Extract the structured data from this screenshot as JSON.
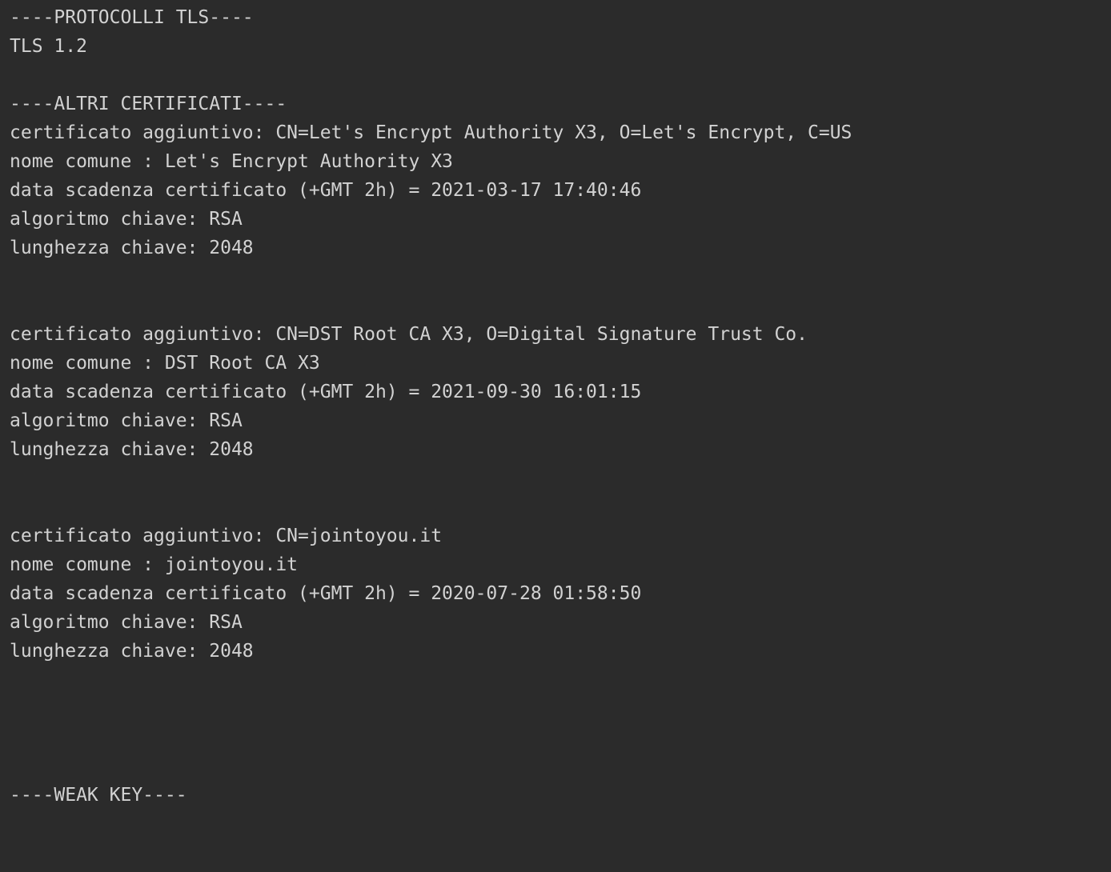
{
  "console": {
    "tls_header": "----PROTOCOLLI TLS----",
    "tls_version": "TLS 1.2",
    "certs_header": "----ALTRI CERTIFICATI----",
    "certificates": [
      {
        "aggiuntivo": "certificato aggiuntivo: CN=Let's Encrypt Authority X3, O=Let's Encrypt, C=US",
        "nome_comune": "nome comune : Let's Encrypt Authority X3",
        "scadenza": "data scadenza certificato (+GMT 2h) = 2021-03-17 17:40:46",
        "algoritmo": "algoritmo chiave: RSA",
        "lunghezza": "lunghezza chiave: 2048"
      },
      {
        "aggiuntivo": "certificato aggiuntivo: CN=DST Root CA X3, O=Digital Signature Trust Co.",
        "nome_comune": "nome comune : DST Root CA X3",
        "scadenza": "data scadenza certificato (+GMT 2h) = 2021-09-30 16:01:15",
        "algoritmo": "algoritmo chiave: RSA",
        "lunghezza": "lunghezza chiave: 2048"
      },
      {
        "aggiuntivo": "certificato aggiuntivo: CN=jointoyou.it",
        "nome_comune": "nome comune : jointoyou.it",
        "scadenza": "data scadenza certificato (+GMT 2h) = 2020-07-28 01:58:50",
        "algoritmo": "algoritmo chiave: RSA",
        "lunghezza": "lunghezza chiave: 2048"
      }
    ],
    "weak_key_header": "----WEAK KEY----"
  }
}
